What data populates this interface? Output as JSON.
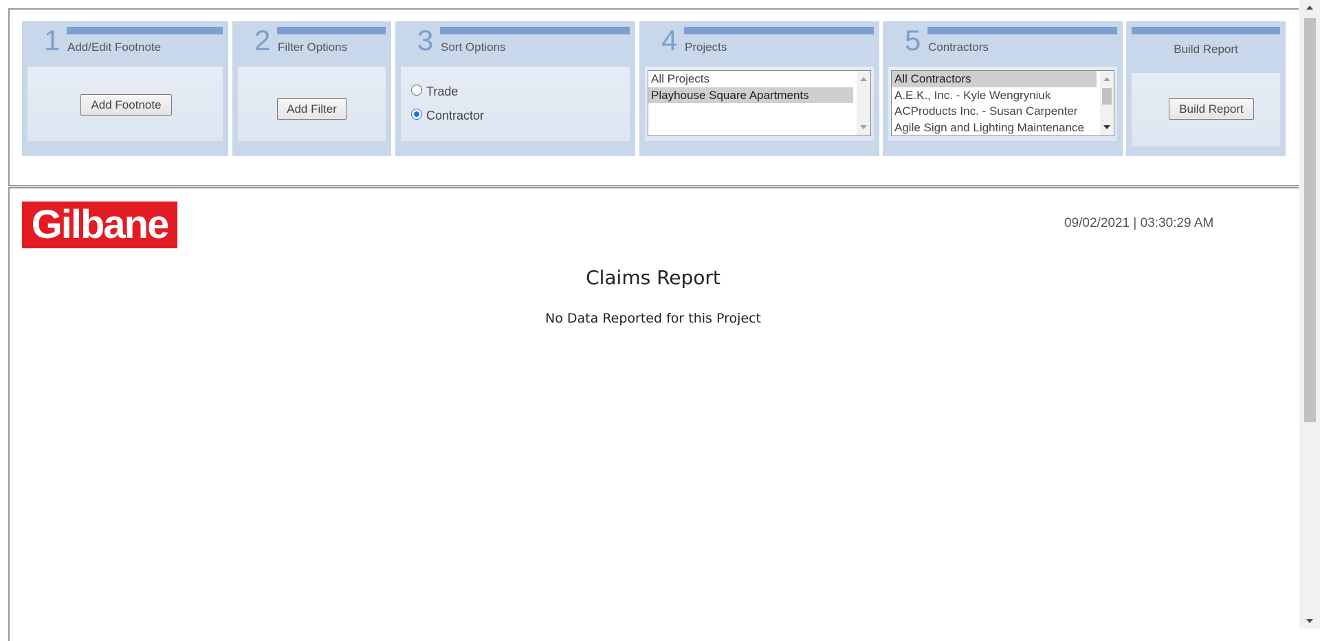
{
  "steps": [
    {
      "number": "1",
      "title": "Add/Edit Footnote",
      "button": "Add Footnote"
    },
    {
      "number": "2",
      "title": "Filter Options",
      "button": "Add Filter"
    },
    {
      "number": "3",
      "title": "Sort Options",
      "options": [
        "Trade",
        "Contractor"
      ],
      "selected": "Contractor"
    },
    {
      "number": "4",
      "title": "Projects",
      "items": [
        "All Projects",
        "Playhouse Square Apartments"
      ],
      "selected": "Playhouse Square Apartments"
    },
    {
      "number": "5",
      "title": "Contractors",
      "items": [
        "All Contractors",
        "A.E.K., Inc. - Kyle Wengryniuk",
        "ACProducts Inc. - Susan Carpenter",
        "Agile Sign and Lighting Maintenance"
      ],
      "selected": "All Contractors"
    },
    {
      "title": "Build Report",
      "button": "Build Report"
    }
  ],
  "report": {
    "logo_text": "Gilbane",
    "timestamp": "09/02/2021 | 03:30:29 AM",
    "title": "Claims Report",
    "message": "No Data Reported for this Project"
  },
  "colors": {
    "panel": "#c8d7e9",
    "accent_bar": "#7e9fd1",
    "step_number": "#7c9ed0",
    "logo_bg": "#e31b23"
  }
}
